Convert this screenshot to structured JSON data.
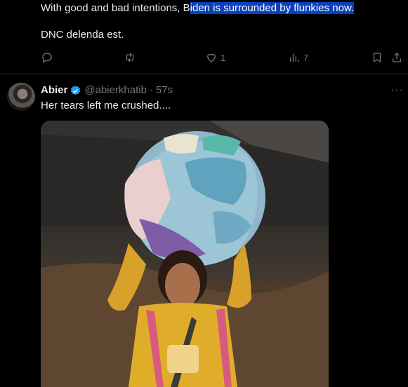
{
  "tweet1": {
    "text_before": "With good and bad intentions, B",
    "text_selected": "iden is surrounded by flunkies now.",
    "text_line2": "DNC delenda est.",
    "like_count": "1",
    "view_count": "7"
  },
  "tweet2": {
    "name": "Abier",
    "handle": "@abierkhatib",
    "separator": "·",
    "time": "57s",
    "text": "Her tears left me crushed....",
    "more_label": "···"
  },
  "icons": {
    "reply": "reply-icon",
    "retweet": "retweet-icon",
    "like": "heart-icon",
    "views": "views-icon",
    "bookmark": "bookmark-icon",
    "share": "share-icon",
    "verified": "verified-badge-icon"
  },
  "colors": {
    "background": "#000000",
    "text": "#e7e9ea",
    "muted": "#71767b",
    "selection": "#0c3fbd",
    "verified": "#1d9bf0"
  }
}
